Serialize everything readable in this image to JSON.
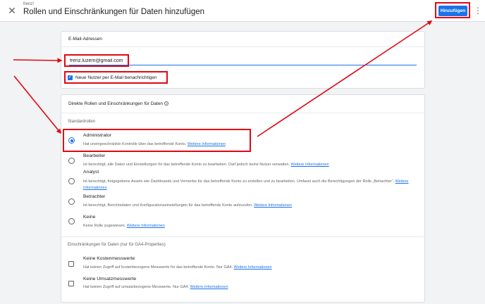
{
  "header": {
    "account": "frenz!",
    "title": "Rollen und Einschränkungen für Daten hinzufügen",
    "add_button": "Hinzufügen",
    "close_icon": "close-icon",
    "more_icon": "more-vert-icon"
  },
  "email_card": {
    "heading": "E-Mail-Adressen",
    "email_value": "frenz.luzern@gmail.com",
    "notify_label": "Neue Nutzer per E-Mail benachrichtigen",
    "notify_checked": true
  },
  "roles_card": {
    "heading": "Direkte Rollen und Einschränkungen für Daten",
    "standard_roles_label": "Standardrollen",
    "roles": [
      {
        "title": "Administrator",
        "desc": "Hat uneingeschränkte Kontrolle über das betreffende Konto.",
        "link": "Weitere Informationen",
        "selected": true
      },
      {
        "title": "Bearbeiter",
        "desc": "Ist berechtigt, alle Daten und Einstellungen für das betreffende Konto zu bearbeiten. Darf jedoch keine Nutzer verwalten.",
        "link": "Weitere Informationen",
        "selected": false
      },
      {
        "title": "Analyst",
        "desc": "Ist berechtigt, freigegebene Assets wie Dashboards und Vermerke für das betreffende Konto zu erstellen und zu bearbeiten. Umfasst auch die Berechtigungen der Rolle „Betrachter“.",
        "link": "Weitere Informationen",
        "selected": false
      },
      {
        "title": "Betrachter",
        "desc": "Ist berechtigt, Berichtsdaten und Konfigurationseinstellungen für das betreffende Konto aufzurufen.",
        "link": "Weitere Informationen",
        "selected": false
      },
      {
        "title": "Keine",
        "desc": "Keine Rolle zugewiesen.",
        "link": "Weitere Informationen",
        "selected": false
      }
    ],
    "restrictions_label": "Einschränkungen für Daten (nur für GA4-Properties)",
    "restrictions": [
      {
        "title": "Keine Kostenmesswerte",
        "desc": "Hat keinen Zugriff auf kostenbezogene Messwerte für das betreffende Konto. Nur GA4.",
        "link": "Weitere Informationen",
        "checked": false
      },
      {
        "title": "Keine Umsatzmesswerte",
        "desc": "Hat keinen Zugriff auf umsatzbezogene Messwerte. Nur GA4.",
        "link": "Weitere Informationen",
        "checked": false
      }
    ]
  },
  "annotation_color": "#e30613",
  "accent_color": "#1a73e8"
}
